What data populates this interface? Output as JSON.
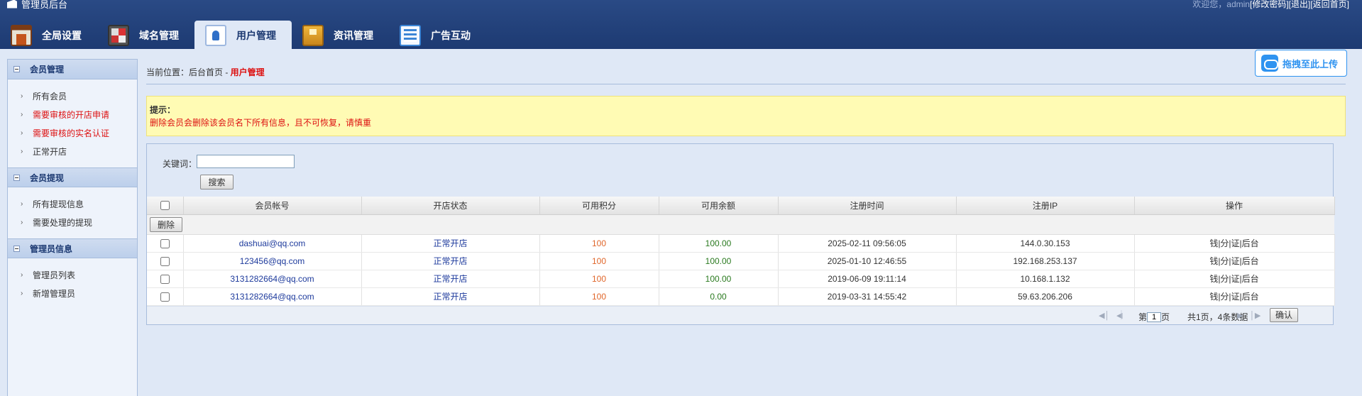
{
  "app": {
    "title": "管理员后台"
  },
  "header": {
    "welcome": "欢迎您，admin",
    "links": [
      "[修改密码]",
      "[退出]",
      "[返回首页]"
    ]
  },
  "nav": {
    "tabs": [
      {
        "label": "全局设置",
        "icon": "global-settings-icon"
      },
      {
        "label": "域名管理",
        "icon": "domain-icon"
      },
      {
        "label": "用户管理",
        "icon": "user-icon",
        "active": true
      },
      {
        "label": "资讯管理",
        "icon": "news-icon"
      },
      {
        "label": "广告互动",
        "icon": "ad-icon"
      }
    ]
  },
  "sidebar": {
    "sections": [
      {
        "title": "会员管理",
        "items": [
          {
            "label": "所有会员",
            "alert": false
          },
          {
            "label": "需要审核的开店申请",
            "alert": true
          },
          {
            "label": "需要审核的实名认证",
            "alert": true
          },
          {
            "label": "正常开店",
            "alert": false
          }
        ]
      },
      {
        "title": "会员提现",
        "items": [
          {
            "label": "所有提现信息",
            "alert": false
          },
          {
            "label": "需要处理的提现",
            "alert": false
          }
        ]
      },
      {
        "title": "管理员信息",
        "items": [
          {
            "label": "管理员列表",
            "alert": false
          },
          {
            "label": "新增管理员",
            "alert": false
          }
        ]
      }
    ]
  },
  "breadcrumb": {
    "prefix": "当前位置：后台首页 - ",
    "current": "用户管理"
  },
  "upload": {
    "label": "拖拽至此上传"
  },
  "notice": {
    "title": "提示：",
    "message": "删除会员会删除该会员名下所有信息，且不可恢复，请慎重"
  },
  "search": {
    "label": "关键词：",
    "value": "",
    "button": "搜索"
  },
  "table": {
    "headers": [
      "会员帐号",
      "开店状态",
      "可用积分",
      "可用余额",
      "注册时间",
      "注册IP",
      "操作"
    ],
    "delete_button": "删除",
    "rows": [
      {
        "account": "dashuai@qq.com",
        "status": "正常开店",
        "points": "100",
        "balance": "100.00",
        "time": "2025-02-11 09:56:05",
        "ip": "144.0.30.153",
        "ops": "钱|分|证|后台"
      },
      {
        "account": "123456@qq.com",
        "status": "正常开店",
        "points": "100",
        "balance": "100.00",
        "time": "2025-01-10 12:46:55",
        "ip": "192.168.253.137",
        "ops": "钱|分|证|后台"
      },
      {
        "account": "3131282664@qq.com",
        "status": "正常开店",
        "points": "100",
        "balance": "100.00",
        "time": "2019-06-09 19:11:14",
        "ip": "10.168.1.132",
        "ops": "钱|分|证|后台"
      },
      {
        "account": "3131282664@qq.com",
        "status": "正常开店",
        "points": "100",
        "balance": "0.00",
        "time": "2019-03-31 14:55:42",
        "ip": "59.63.206.206",
        "ops": "钱|分|证|后台"
      }
    ]
  },
  "pager": {
    "page_prefix": "第",
    "page_value": "1",
    "page_suffix": "页",
    "total": "共1页，4条数据",
    "confirm": "确认"
  }
}
